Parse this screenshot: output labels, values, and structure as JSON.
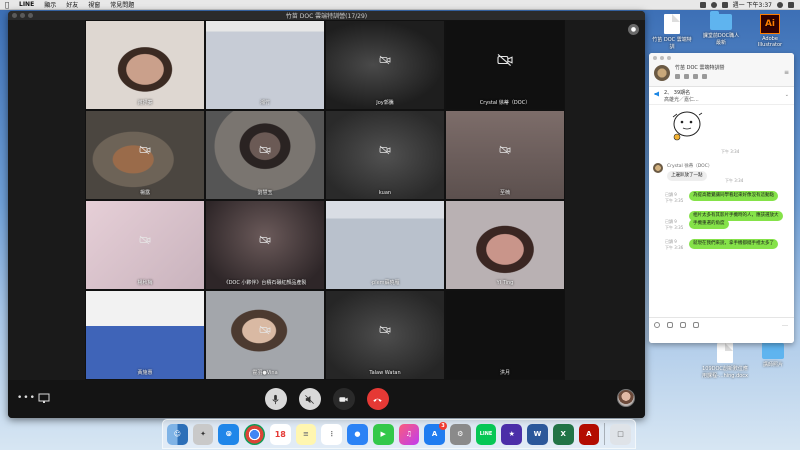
{
  "menubar": {
    "app_name": "LINE",
    "items": [
      "顯示",
      "好友",
      "視窗",
      "常見問題"
    ],
    "clock": "週一 下午3:37"
  },
  "call": {
    "window_title": "竹苗 DOC 雲端特訓營(17/29)",
    "participants": [
      {
        "name": "謝妤蓁",
        "camera_off": false,
        "bg": "face1"
      },
      {
        "name": "湘竹",
        "camera_off": false,
        "bg": "desk"
      },
      {
        "name": "Joy郭騰",
        "camera_off": true,
        "bg": "blur1"
      },
      {
        "name": "Crystal 徐蒂（DOC）",
        "camera_off": true,
        "bg": "black",
        "big_icon": true
      },
      {
        "name": "楊露",
        "camera_off": true,
        "bg": "child"
      },
      {
        "name": "劉慧玉",
        "camera_off": true,
        "bg": "glass"
      },
      {
        "name": "kuan",
        "camera_off": true,
        "bg": "kuan"
      },
      {
        "name": "至楠",
        "camera_off": true,
        "bg": "room"
      },
      {
        "name": "楊秋梅",
        "camera_off": true,
        "bg": "pink"
      },
      {
        "name": "《DOC 小夥伴》台積石碾紅顏品產製",
        "camera_off": true,
        "bg": "tree"
      },
      {
        "name": "·plem蘇曉雁",
        "camera_off": false,
        "bg": "desk2"
      },
      {
        "name": "YI Ting",
        "camera_off": false,
        "bg": "yiting"
      },
      {
        "name": "黃施惠",
        "camera_off": false,
        "bg": "boy"
      },
      {
        "name": "霍羽●Vina",
        "camera_off": true,
        "bg": "vina"
      },
      {
        "name": "Talaw Watan",
        "camera_off": true,
        "bg": "talaw"
      },
      {
        "name": "洪月",
        "camera_off": false,
        "bg": "black"
      }
    ]
  },
  "desktop": {
    "icons": [
      {
        "label": "竹苗 DOC 雲端特訓",
        "type": "doc"
      },
      {
        "label": "課堂前DOC職人最新",
        "type": "folder"
      },
      {
        "label": "Adobe Illustrator",
        "type": "ai"
      },
      {
        "label": "109DOC創新數位應用課程-...hing.docx",
        "type": "doc"
      },
      {
        "label": "講師照片",
        "type": "folder"
      }
    ]
  },
  "chat": {
    "title": "竹苗 DOC 雲端特訓營",
    "notice_line1": "2、 39期名",
    "notice_line2": "高雄光／嘉仁...",
    "sticker_time": "下午 3:34",
    "sender_name": "Crystal 徐蒂（DOC）",
    "messages": [
      {
        "dir": "in",
        "text": "上邊趴放了一點",
        "time": "下午 3:34"
      },
      {
        "dir": "out",
        "text": "為提高聽覺讓同學看起來好像沒有這動點",
        "time": "下午 3:35",
        "read": "已讀 9"
      },
      {
        "dir": "out",
        "text": "相片太多有其影片手機時的人，應該選放大",
        "time": "",
        "read": "已讀 9"
      },
      {
        "dir": "out",
        "text": "手機重選的角度",
        "time": "下午 3:35",
        "read": ""
      },
      {
        "dir": "out",
        "text": "就現在我們來說，拿手機都擺手裡太多了",
        "time": "下午 3:36",
        "read": "已讀 9"
      }
    ]
  },
  "colors": {
    "accent_green": "#85e249",
    "hangup_red": "#e53935"
  }
}
